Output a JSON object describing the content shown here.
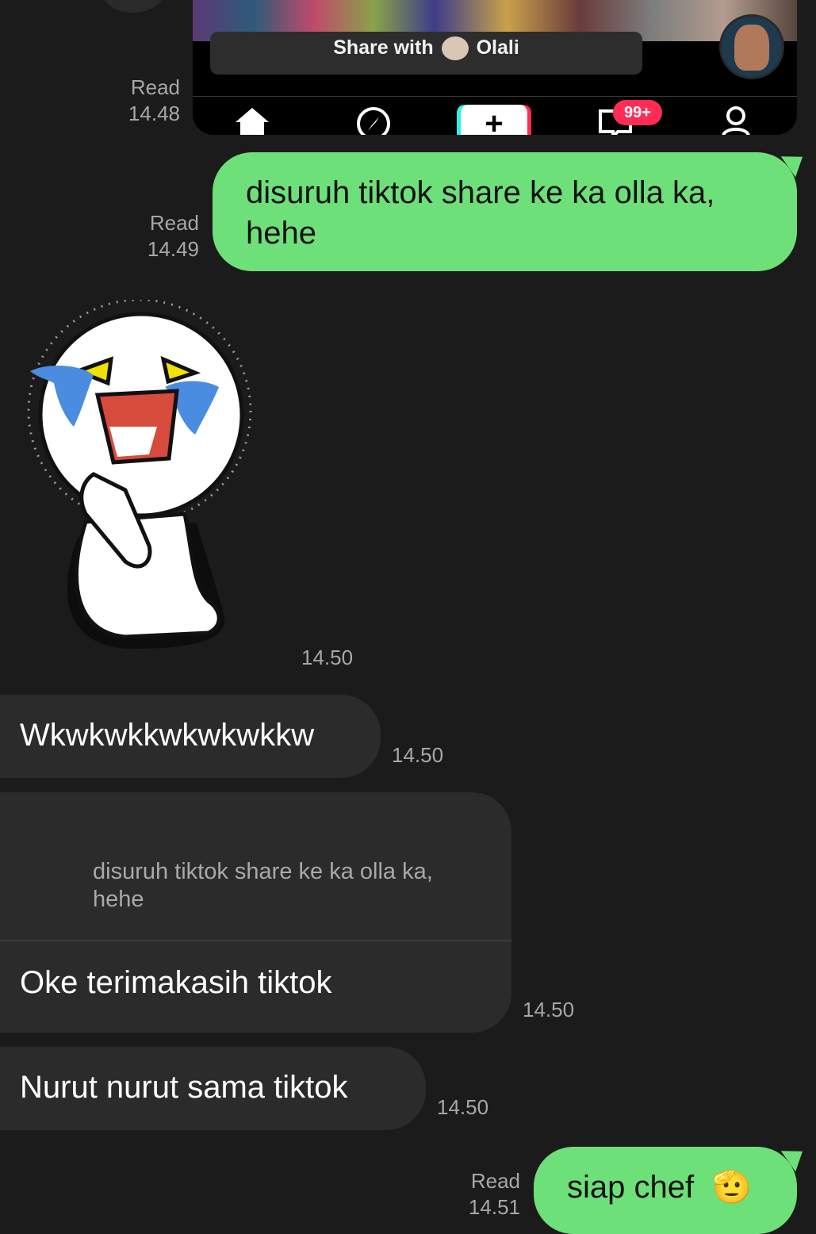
{
  "image_message": {
    "share_prefix": "Share with",
    "share_name": "Olali",
    "badge": "99+",
    "status": "Read",
    "time": "14.48",
    "nav_icons": [
      "home-icon",
      "compass-icon",
      "plus-icon",
      "inbox-icon",
      "profile-icon"
    ]
  },
  "messages": [
    {
      "direction": "out",
      "text": "disuruh tiktok share ke ka olla ka, hehe",
      "status": "Read",
      "time": "14.49"
    },
    {
      "direction": "in",
      "type": "sticker",
      "sticker": "crying-praying-sticker",
      "time": "14.50"
    },
    {
      "direction": "in",
      "text": "Wkwkwkkwkwkwkkw",
      "time": "14.50"
    },
    {
      "direction": "in",
      "reply_quote": "disuruh tiktok share ke ka olla ka, hehe",
      "text": "Oke terimakasih tiktok",
      "time": "14.50"
    },
    {
      "direction": "in",
      "text": "Nurut nurut sama tiktok",
      "time": "14.50"
    },
    {
      "direction": "out",
      "text": "siap chef",
      "emoji": "🫡",
      "status": "Read",
      "time": "14.51"
    }
  ],
  "colors": {
    "background": "#1b1b1b",
    "outgoing": "#6ee07a",
    "incoming": "#2b2b2b",
    "meta": "#a7a7a7"
  }
}
